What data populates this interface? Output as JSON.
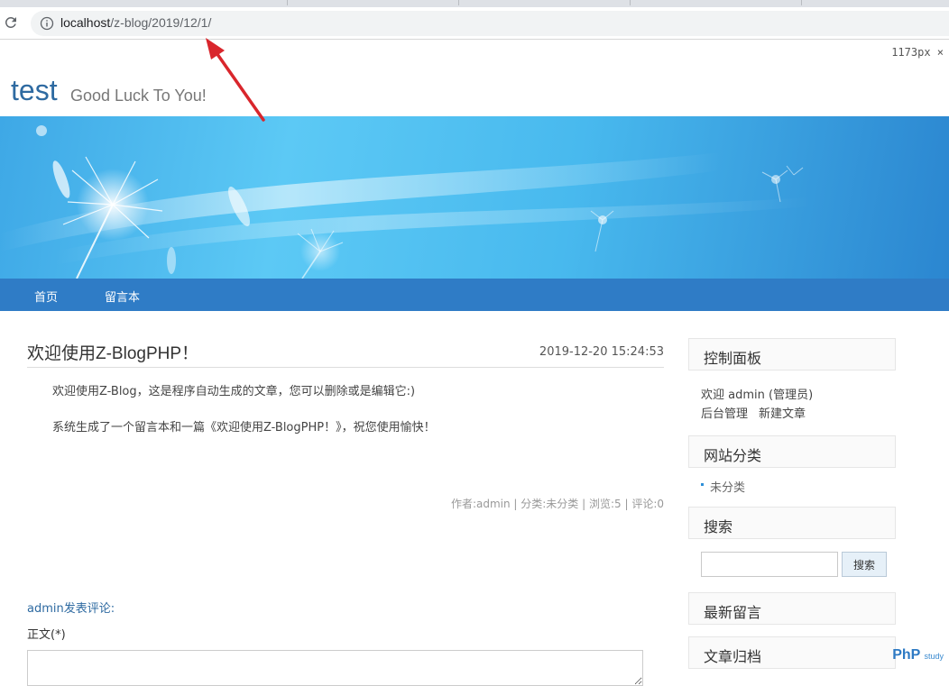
{
  "browser": {
    "url_host": "localhost",
    "url_path": "/z-blog/2019/12/1/",
    "viewport_badge": "1173px ×"
  },
  "site": {
    "title": "test",
    "subtitle": "Good Luck To You!"
  },
  "nav": {
    "items": [
      {
        "label": "首页"
      },
      {
        "label": "留言本"
      }
    ]
  },
  "post": {
    "title": "欢迎使用Z-BlogPHP！",
    "date": "2019-12-20 15:24:53",
    "paragraphs": [
      "欢迎使用Z-Blog，这是程序自动生成的文章，您可以删除或是编辑它:)",
      "系统生成了一个留言本和一篇《欢迎使用Z-BlogPHP！》，祝您使用愉快！"
    ],
    "meta": "作者:admin | 分类:未分类 | 浏览:5 | 评论:0"
  },
  "comment": {
    "heading": "admin发表评论:",
    "body_label": "正文(*)"
  },
  "sidebar": {
    "control_panel": {
      "title": "控制面板",
      "welcome": "欢迎 admin (管理员)",
      "links": [
        "后台管理",
        "新建文章"
      ]
    },
    "categories": {
      "title": "网站分类",
      "items": [
        "未分类"
      ]
    },
    "search": {
      "title": "搜索",
      "button": "搜索",
      "input_value": ""
    },
    "latest_comments": {
      "title": "最新留言"
    },
    "archives": {
      "title": "文章归档"
    }
  },
  "watermark": {
    "main": "PhP",
    "sub": "study"
  },
  "colors": {
    "nav": "#2f7cc6",
    "title_blue": "#2e6aa1",
    "annotation_arrow": "#d9262c"
  }
}
